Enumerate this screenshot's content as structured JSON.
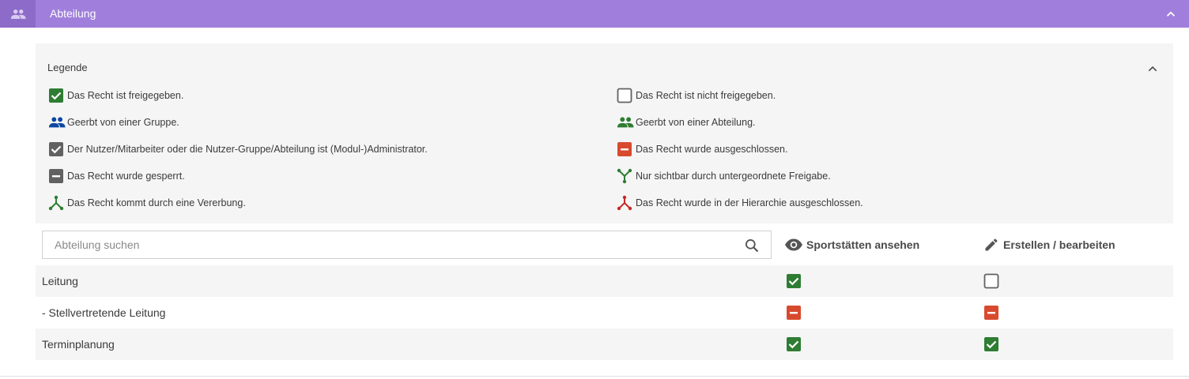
{
  "header": {
    "title": "Abteilung",
    "icon": "people-icon",
    "collapse_icon": "chevron-up-icon",
    "color": "#a07fdc"
  },
  "legend": {
    "title": "Legende",
    "items": [
      {
        "text": "Das Recht ist freigegeben.",
        "icon": "checkbox-checked-green-icon"
      },
      {
        "text": "Das Recht ist nicht freigegeben.",
        "icon": "checkbox-empty-icon"
      },
      {
        "text": "Geerbt von einer Gruppe.",
        "icon": "group-blue-icon"
      },
      {
        "text": "Geerbt von einer Abteilung.",
        "icon": "group-green-icon"
      },
      {
        "text": "Der Nutzer/Mitarbeiter oder die Nutzer-Gruppe/Abteilung ist (Modul-)Administrator.",
        "icon": "checkbox-checked-grey-icon"
      },
      {
        "text": "Das Recht wurde ausgeschlossen.",
        "icon": "minus-red-icon"
      },
      {
        "text": "Das Recht wurde gesperrt.",
        "icon": "minus-grey-icon"
      },
      {
        "text": "Nur sichtbar durch untergeordnete Freigabe.",
        "icon": "merge-green-icon"
      },
      {
        "text": "Das Recht kommt durch eine Vererbung.",
        "icon": "split-green-icon"
      },
      {
        "text": "Das Recht wurde in der Hierarchie ausgeschlossen.",
        "icon": "split-red-icon"
      }
    ]
  },
  "search": {
    "placeholder": "Abteilung suchen",
    "value": ""
  },
  "columns": [
    {
      "label": "Sportstätten ansehen",
      "icon": "eye-icon"
    },
    {
      "label": "Erstellen / bearbeiten",
      "icon": "pencil-icon"
    }
  ],
  "rows": [
    {
      "label": "Leitung",
      "rights": [
        "checked",
        "unchecked"
      ]
    },
    {
      "label": "- Stellvertretende Leitung",
      "rights": [
        "excluded",
        "excluded"
      ]
    },
    {
      "label": "Terminplanung",
      "rights": [
        "checked",
        "checked"
      ]
    }
  ],
  "colors": {
    "green": "#2e7d32",
    "red": "#c62828",
    "blue": "#0d47a1",
    "grey": "#616161",
    "excluded": "#d84a2e"
  }
}
